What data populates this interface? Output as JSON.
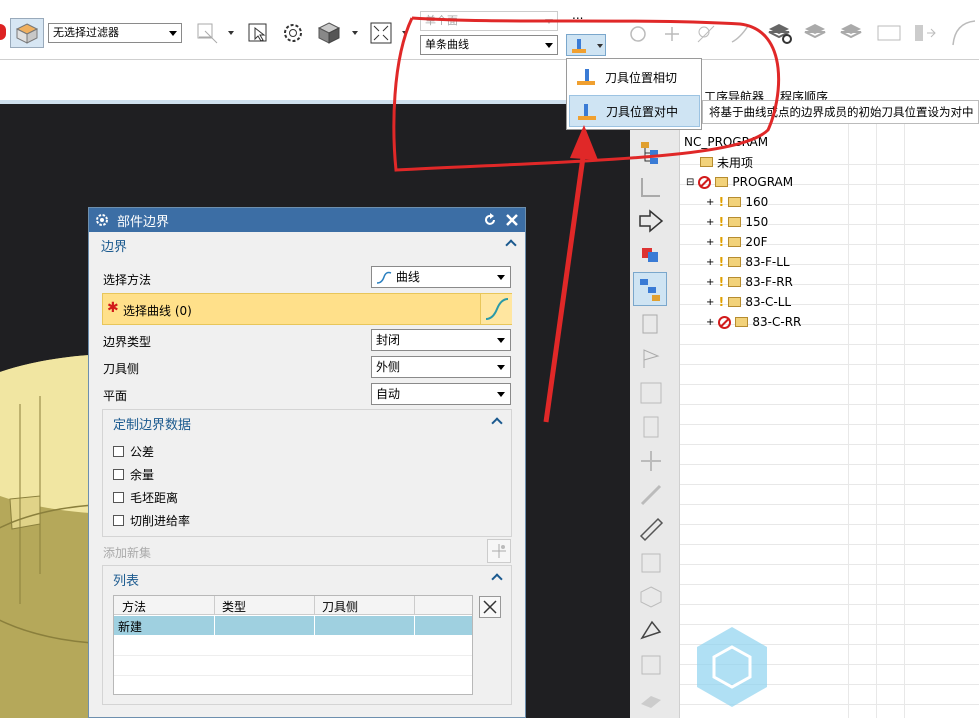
{
  "toolbar": {
    "filter_value": "无选择过滤器",
    "scope_value": "单个面",
    "curve_rule_value": "单条曲线",
    "more_label": "..."
  },
  "nav_header": {
    "col1": "工序导航器",
    "col2": "程序顺序"
  },
  "popup_menu": {
    "items": [
      {
        "label": "刀具位置相切"
      },
      {
        "label": "刀具位置对中"
      }
    ],
    "tooltip": "将基于曲线或点的边界成员的初始刀具位置设为对中"
  },
  "dialog": {
    "title": "部件边界",
    "section_boundary": "边界",
    "select_method_label": "选择方法",
    "select_method_value": "曲线",
    "select_curve_label": "选择曲线 (0)",
    "boundary_type_label": "边界类型",
    "boundary_type_value": "封闭",
    "tool_side_label": "刀具侧",
    "tool_side_value": "外侧",
    "plane_label": "平面",
    "plane_value": "自动",
    "custom_section": "定制边界数据",
    "checkboxes": [
      "公差",
      "余量",
      "毛坯距离",
      "切削进给率"
    ],
    "add_new_set": "添加新集",
    "list_section": "列表",
    "table_headers": [
      "方法",
      "类型",
      "刀具侧"
    ],
    "table_rows": [
      [
        "新建",
        "",
        ""
      ]
    ]
  },
  "tree": {
    "root": "NC_PROGRAM",
    "unused": "未用项",
    "program": "PROGRAM",
    "children": [
      "160",
      "150",
      "20F",
      "83-F-LL",
      "83-F-RR",
      "83-C-LL",
      "83-C-RR"
    ]
  },
  "colors": {
    "accent": "#3c6ea5",
    "highlight_row": "#ffe08a",
    "selected_row": "#9fd0e0",
    "annotation_red": "#e02828"
  }
}
